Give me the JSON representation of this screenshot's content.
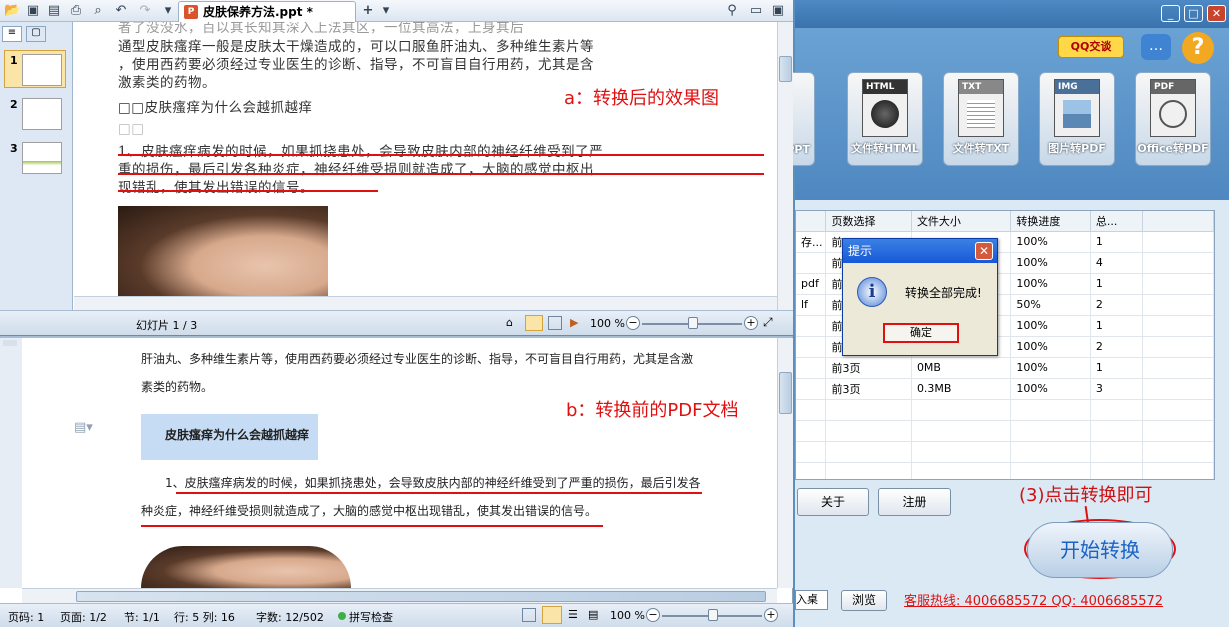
{
  "ppt": {
    "doc_tab": "皮肤保养方法.ppt *",
    "thumbs": [
      "1",
      "2",
      "3"
    ],
    "slide_lines": [
      "者了没没水，百以其长知其深入上法其区，一位其高法，上身其后",
      "通型皮肤瘙痒一般是皮肤太干燥造成的，可以口服鱼肝油丸、多种维生素片等",
      "，使用西药要必须经过专业医生的诊断、指导，不可盲目自行用药，尤其是含",
      "激素类的药物。",
      "□□皮肤瘙痒为什么会越抓越痒",
      "□□",
      "1、皮肤瘙痒病发的时候，如果抓挠患处，会导致皮肤内部的神经纤维受到了严",
      "重的损伤，最后引发各种炎症，神经纤维受损则就造成了，大脑的感觉中枢出",
      "现错乱，使其发出错误的信号。"
    ],
    "annotation_a": "a：转换后的效果图",
    "status_slide": "幻灯片 1 / 3",
    "zoom": "100 %"
  },
  "doc": {
    "lines": [
      "肝油丸、多种维生素片等，使用西药要必须经过专业医生的诊断、指导，不可盲目自行用药，尤其是含激",
      "素类的药物。"
    ],
    "heading": "皮肤瘙痒为什么会越抓越痒",
    "para1": "1、皮肤瘙痒病发的时候，如果抓挠患处，会导致皮肤内部的神经纤维受到了严重的损伤，最后引发各",
    "para2": "种炎症，神经纤维受损则就造成了，大脑的感觉中枢出现错乱，使其发出错误的信号。",
    "annotation_b": "b：转换前的PDF文档",
    "status": {
      "page": "页码: 1",
      "pages": "页面: 1/2",
      "section": "节: 1/1",
      "rowcol": "行: 5  列: 16",
      "words": "字数: 12/502",
      "spell": "拼写检查",
      "zoom": "100 %"
    }
  },
  "app": {
    "qq_label": "QQ交谈",
    "converters": [
      {
        "tag": "",
        "label": "PPT"
      },
      {
        "tag": "HTML",
        "label": "文件转HTML"
      },
      {
        "tag": "TXT",
        "label": "文件转TXT"
      },
      {
        "tag": "IMG",
        "label": "图片转PDF"
      },
      {
        "tag": "PDF",
        "label": "Office转PDF"
      }
    ],
    "table": {
      "headers": [
        "",
        "页数选择",
        "文件大小",
        "转换进度",
        "总..."
      ],
      "rows": [
        [
          "存...",
          "前",
          "",
          "100%",
          "1"
        ],
        [
          "",
          "前",
          "",
          "100%",
          "4"
        ],
        [
          "pdf",
          "前",
          "",
          "100%",
          "1"
        ],
        [
          "lf",
          "前",
          "",
          "50%",
          "2"
        ],
        [
          "",
          "前",
          "",
          "100%",
          "1"
        ],
        [
          "",
          "前",
          "",
          "100%",
          "2"
        ],
        [
          "",
          "前3页",
          "0MB",
          "100%",
          "1"
        ],
        [
          "",
          "前3页",
          "0.3MB",
          "100%",
          "3"
        ],
        [
          "",
          "",
          "",
          "",
          ""
        ],
        [
          "",
          "",
          "",
          "",
          ""
        ],
        [
          "",
          "",
          "",
          "",
          ""
        ],
        [
          "",
          "",
          "",
          "",
          ""
        ]
      ]
    },
    "dialog": {
      "title": "提示",
      "message": "转换全部完成!",
      "ok": "确定"
    },
    "about": "关于",
    "register": "注册",
    "hint": "(3)点击转换即可",
    "start": "开始转换",
    "desktop": "入桌面",
    "browse": "浏览",
    "hotline": "客服热线: 4006685572 QQ: 4006685572"
  }
}
